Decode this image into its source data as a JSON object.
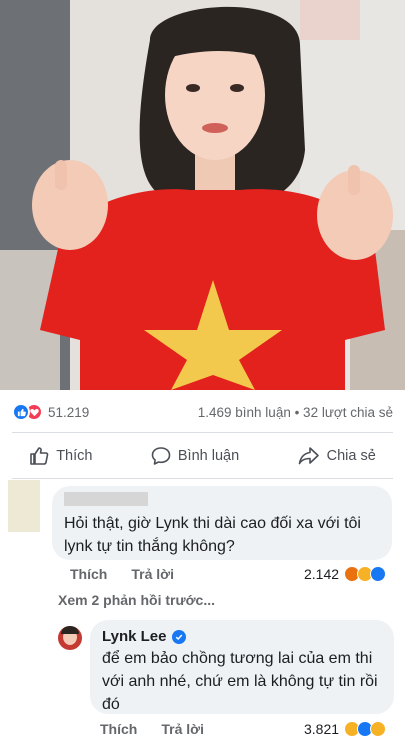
{
  "post": {
    "reactions_count": "51.219",
    "comments_shares": "1.469 bình luận • 32 lượt chia sẻ"
  },
  "actions": {
    "like": "Thích",
    "comment": "Bình luận",
    "share": "Chia sẻ"
  },
  "comments": [
    {
      "text": "Hỏi thật, giờ Lynk thi dài cao đối xa với tôi lynk tự tin thắng không?",
      "like_label": "Thích",
      "reply_label": "Trả lời",
      "reaction_count": "2.142"
    }
  ],
  "more_replies": "Xem 2 phản hồi trước...",
  "reply": {
    "author": "Lynk Lee",
    "text": "để em bảo chồng tương lai của em thi với anh nhé, chứ em là không tự tin rồi đó",
    "like_label": "Thích",
    "reply_label": "Trả lời",
    "reaction_count": "3.821"
  },
  "colors": {
    "like_blue": "#1877f2",
    "love_red": "#f33e58",
    "shirt_red": "#e3211d",
    "star_yellow": "#f2c94c"
  }
}
